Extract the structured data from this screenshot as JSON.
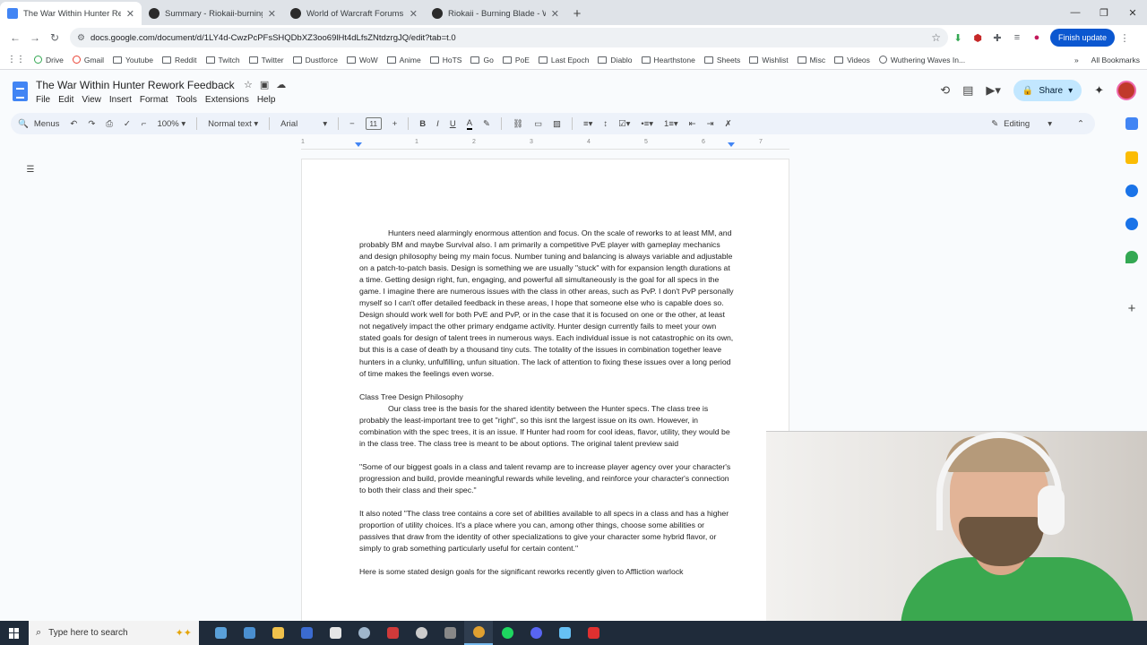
{
  "browser": {
    "tabs": [
      {
        "title": "The War Within Hunter Rework",
        "active": true,
        "color": "#4285f4"
      },
      {
        "title": "Summary - Riokaii-burning-bla",
        "active": false,
        "color": "#2b2b2b"
      },
      {
        "title": "World of Warcraft Forums",
        "active": false,
        "color": "#2b2b2b"
      },
      {
        "title": "Riokaii - Burning Blade - Warcr",
        "active": false,
        "color": "#2b2b2b"
      }
    ],
    "new_tab": "+",
    "url": "docs.google.com/document/d/1LY4d-CwzPcPFsSHQDbXZ3oo69lHt4dLfsZNtdzrgJQ/edit?tab=t.0",
    "finish_update": "Finish update",
    "bookmarks": [
      "Drive",
      "Gmail",
      "Youtube",
      "Reddit",
      "Twitch",
      "Twitter",
      "Dustforce",
      "WoW",
      "Anime",
      "HoTS",
      "Go",
      "PoE",
      "Last Epoch",
      "Diablo",
      "Hearthstone",
      "Sheets",
      "Wishlist",
      "Misc",
      "Videos",
      "Wuthering Waves In..."
    ],
    "all_bookmarks": "All Bookmarks"
  },
  "docs": {
    "title": "The War Within Hunter Rework Feedback",
    "menu": [
      "File",
      "Edit",
      "View",
      "Insert",
      "Format",
      "Tools",
      "Extensions",
      "Help"
    ],
    "share": "Share",
    "toolbar": {
      "menus": "Menus",
      "zoom": "100%",
      "style": "Normal text",
      "font": "Arial",
      "font_size": "11",
      "mode": "Editing"
    },
    "ruler_numbers": [
      "1",
      "1",
      "2",
      "3",
      "4",
      "5",
      "6",
      "7"
    ]
  },
  "document": {
    "p1": "Hunters need alarmingly enormous attention and focus. On the scale of reworks to at least MM, and probably BM and maybe Survival also. I am primarily a competitive PvE player with gameplay mechanics and design philosophy being my main focus. Number tuning and balancing is always variable and adjustable on a patch-to-patch basis. Design is something we are usually \"stuck\" with for expansion length durations at a time. Getting design right, fun, engaging, and powerful all simultaneously is the goal for all specs in the game. I imagine there are numerous issues with the class in other areas, such as PvP. I don't PvP personally myself so I can't offer detailed feedback in these areas, I hope that someone else who is capable does so. Design should work well for both PvE and PvP, or in the case that it is focused on one or the other, at least not negatively impact the other primary endgame activity. Hunter design currently fails to meet your own stated goals for design of talent trees in numerous ways. Each individual issue is not catastrophic on its own, but this is a case of death by a thousand tiny cuts. The totality of the issues in combination together leave hunters in a clunky, unfulfilling, unfun situation. The lack of attention to fixing these issues over a long period of time makes the feelings even worse.",
    "heading1": "Class Tree Design Philosophy",
    "p2": "Our class tree is the basis for the shared identity between the Hunter specs. The class tree is probably the least-important tree to get \"right\", so this isnt the largest issue on its own. However, in combination with the spec trees, it is an issue. If Hunter had room for cool ideas, flavor, utility, they would be in the class tree. The class tree is meant to be about options. The original talent preview said",
    "quote1": "\"Some of our biggest goals in a class and talent revamp are to increase player agency over your character's progression and build, provide meaningful rewards while leveling, and reinforce your character's connection to both their class and their spec.\"",
    "p3": "It also noted \"The class tree contains a core set of abilities available to all specs in a class and has a higher proportion of utility choices. It's a place where you can, among other things, choose some abilities or passives that draw from the identity of other specializations to give your character some hybrid flavor, or simply to grab something particularly useful for certain content.\"",
    "p4": "Here is some stated design goals for the significant reworks recently given to Affliction warlock"
  },
  "taskbar": {
    "search_placeholder": "Type here to search",
    "apps": [
      {
        "name": "notes",
        "color": "#5aa0d8"
      },
      {
        "name": "calculator",
        "color": "#4a8fd0"
      },
      {
        "name": "explorer",
        "color": "#f0c14b"
      },
      {
        "name": "app-blue",
        "color": "#3b6bd0"
      },
      {
        "name": "app-dark",
        "color": "#e5e5e5"
      },
      {
        "name": "steam",
        "color": "#9fb6cc"
      },
      {
        "name": "app-red",
        "color": "#d03a3a"
      },
      {
        "name": "app-circle",
        "color": "#cccccc"
      },
      {
        "name": "app-game",
        "color": "#888888"
      },
      {
        "name": "chrome",
        "color": "#e0a030"
      },
      {
        "name": "spotify",
        "color": "#1ed760"
      },
      {
        "name": "discord",
        "color": "#5865f2"
      },
      {
        "name": "steam2",
        "color": "#66c0f4"
      },
      {
        "name": "app-red2",
        "color": "#e03030"
      }
    ]
  }
}
